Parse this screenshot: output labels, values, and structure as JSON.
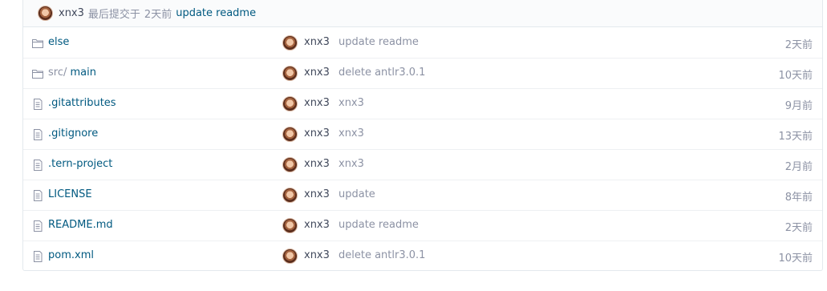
{
  "last_commit": {
    "author": "xnx3",
    "label": "最后提交于",
    "time": "2天前",
    "message": "update readme"
  },
  "files": [
    {
      "type": "folder",
      "prefix": "",
      "name": "else",
      "author": "xnx3",
      "message": "update readme",
      "time": "2天前",
      "icon": "folder-icon"
    },
    {
      "type": "folder",
      "prefix": "src/",
      "name": " main",
      "author": "xnx3",
      "message": "delete antlr3.0.1",
      "time": "10天前",
      "icon": "folder-icon"
    },
    {
      "type": "file",
      "prefix": "",
      "name": ".gitattributes",
      "author": "xnx3",
      "message": "xnx3",
      "time": "9月前",
      "icon": "file-icon"
    },
    {
      "type": "file",
      "prefix": "",
      "name": ".gitignore",
      "author": "xnx3",
      "message": "xnx3",
      "time": "13天前",
      "icon": "file-icon"
    },
    {
      "type": "file",
      "prefix": "",
      "name": ".tern-project",
      "author": "xnx3",
      "message": "xnx3",
      "time": "2月前",
      "icon": "file-icon"
    },
    {
      "type": "file",
      "prefix": "",
      "name": "LICENSE",
      "author": "xnx3",
      "message": "update",
      "time": "8年前",
      "icon": "file-icon"
    },
    {
      "type": "file",
      "prefix": "",
      "name": "README.md",
      "author": "xnx3",
      "message": "update readme",
      "time": "2天前",
      "icon": "file-icon"
    },
    {
      "type": "file",
      "prefix": "",
      "name": "pom.xml",
      "author": "xnx3",
      "message": "delete antlr3.0.1",
      "time": "10天前",
      "icon": "file-icon"
    }
  ],
  "colors": {
    "link": "#005980",
    "muted": "#8c92a4",
    "text": "#40485b",
    "border": "#e3e9ed"
  }
}
